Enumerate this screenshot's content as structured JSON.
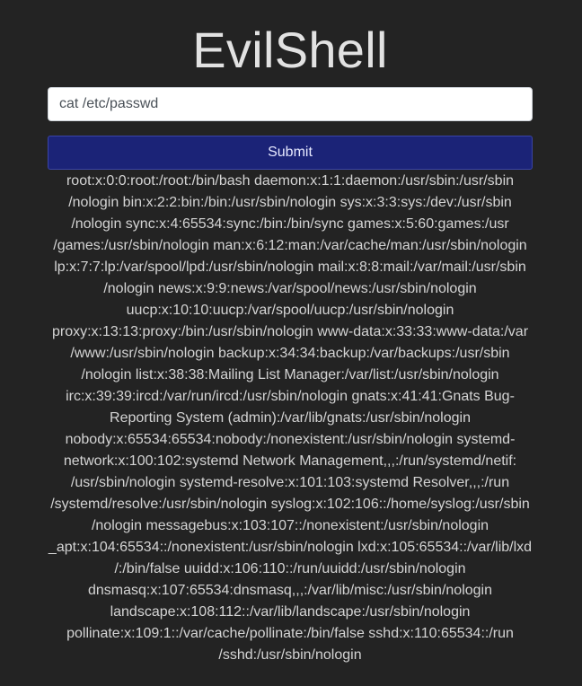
{
  "title": "EvilShell",
  "command_input": {
    "value": "cat /etc/passwd"
  },
  "submit_label": "Submit",
  "output_lines": [
    "root:x:0:0:root:/root:/bin/bash daemon:x:1:1:daemon:/usr/sbin:/usr/sbin",
    "/nologin bin:x:2:2:bin:/bin:/usr/sbin/nologin sys:x:3:3:sys:/dev:/usr/sbin",
    "/nologin sync:x:4:65534:sync:/bin:/bin/sync games:x:5:60:games:/usr",
    "/games:/usr/sbin/nologin man:x:6:12:man:/var/cache/man:/usr/sbin/nologin",
    "lp:x:7:7:lp:/var/spool/lpd:/usr/sbin/nologin mail:x:8:8:mail:/var/mail:/usr/sbin",
    "/nologin news:x:9:9:news:/var/spool/news:/usr/sbin/nologin",
    "uucp:x:10:10:uucp:/var/spool/uucp:/usr/sbin/nologin",
    "proxy:x:13:13:proxy:/bin:/usr/sbin/nologin www-data:x:33:33:www-data:/var",
    "/www:/usr/sbin/nologin backup:x:34:34:backup:/var/backups:/usr/sbin",
    "/nologin list:x:38:38:Mailing List Manager:/var/list:/usr/sbin/nologin",
    "irc:x:39:39:ircd:/var/run/ircd:/usr/sbin/nologin gnats:x:41:41:Gnats Bug-",
    "Reporting System (admin):/var/lib/gnats:/usr/sbin/nologin",
    "nobody:x:65534:65534:nobody:/nonexistent:/usr/sbin/nologin systemd-",
    "network:x:100:102:systemd Network Management,,,:/run/systemd/netif:",
    "/usr/sbin/nologin systemd-resolve:x:101:103:systemd Resolver,,,:/run",
    "/systemd/resolve:/usr/sbin/nologin syslog:x:102:106::/home/syslog:/usr/sbin",
    "/nologin messagebus:x:103:107::/nonexistent:/usr/sbin/nologin",
    "_apt:x:104:65534::/nonexistent:/usr/sbin/nologin lxd:x:105:65534::/var/lib/lxd",
    "/:/bin/false uuidd:x:106:110::/run/uuidd:/usr/sbin/nologin",
    "dnsmasq:x:107:65534:dnsmasq,,,:/var/lib/misc:/usr/sbin/nologin",
    "landscape:x:108:112::/var/lib/landscape:/usr/sbin/nologin",
    "pollinate:x:109:1::/var/cache/pollinate:/bin/false sshd:x:110:65534::/run",
    "/sshd:/usr/sbin/nologin"
  ]
}
